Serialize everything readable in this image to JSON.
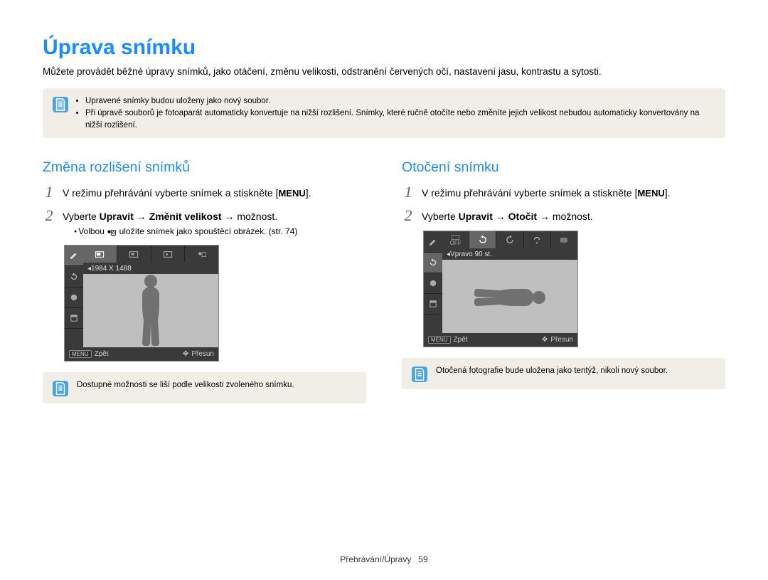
{
  "title": "Úprava snímku",
  "intro": "Můžete provádět běžné úpravy snímků, jako otáčení, změnu velikosti, odstranění červených očí, nastavení jasu, kontrastu a sytosti.",
  "top_note": {
    "bullets": [
      "Upravené snímky budou uloženy jako nový soubor.",
      "Při úpravě souborů je fotoaparát automaticky konvertuje na nižší rozlišení. Snímky, které ručně otočíte nebo změníte jejich velikost nebudou automaticky konvertovány na nižší rozlišení."
    ]
  },
  "left": {
    "heading": "Změna rozlišení snímků",
    "step1_pre": "V režimu přehrávání vyberte snímek a stiskněte [",
    "step1_menu": "MENU",
    "step1_post": "].",
    "step2_pre": "Vyberte ",
    "step2_b1": "Upravit",
    "step2_arrow1": " → ",
    "step2_b2": "Změnit velikost",
    "step2_arrow2": " → ",
    "step2_post": "možnost.",
    "step2_sub": "Volbou       uložíte snímek jako spouštěcí obrázek. (str. 74)",
    "lcd": {
      "info": "1984 X 1488",
      "back_chip": "MENU",
      "back_label": "Zpět",
      "move_label": "Přesun"
    },
    "bottom_note": "Dostupné možnosti se liší podle velikosti zvoleného snímku."
  },
  "right": {
    "heading": "Otočení snímku",
    "step1_pre": "V režimu přehrávání vyberte snímek a stiskněte [",
    "step1_menu": "MENU",
    "step1_post": "].",
    "step2_pre": "Vyberte ",
    "step2_b1": "Upravit",
    "step2_arrow1": " → ",
    "step2_b2": "Otočit",
    "step2_arrow2": " → ",
    "step2_post": "možnost.",
    "lcd": {
      "info": "Vpravo 90 st.",
      "back_chip": "MENU",
      "back_label": "Zpět",
      "move_label": "Přesun"
    },
    "bottom_note": "Otočená fotografie bude uložena jako tentýž, nikoli nový soubor."
  },
  "footer": {
    "section": "Přehrávání/Úpravy",
    "page": "59"
  }
}
